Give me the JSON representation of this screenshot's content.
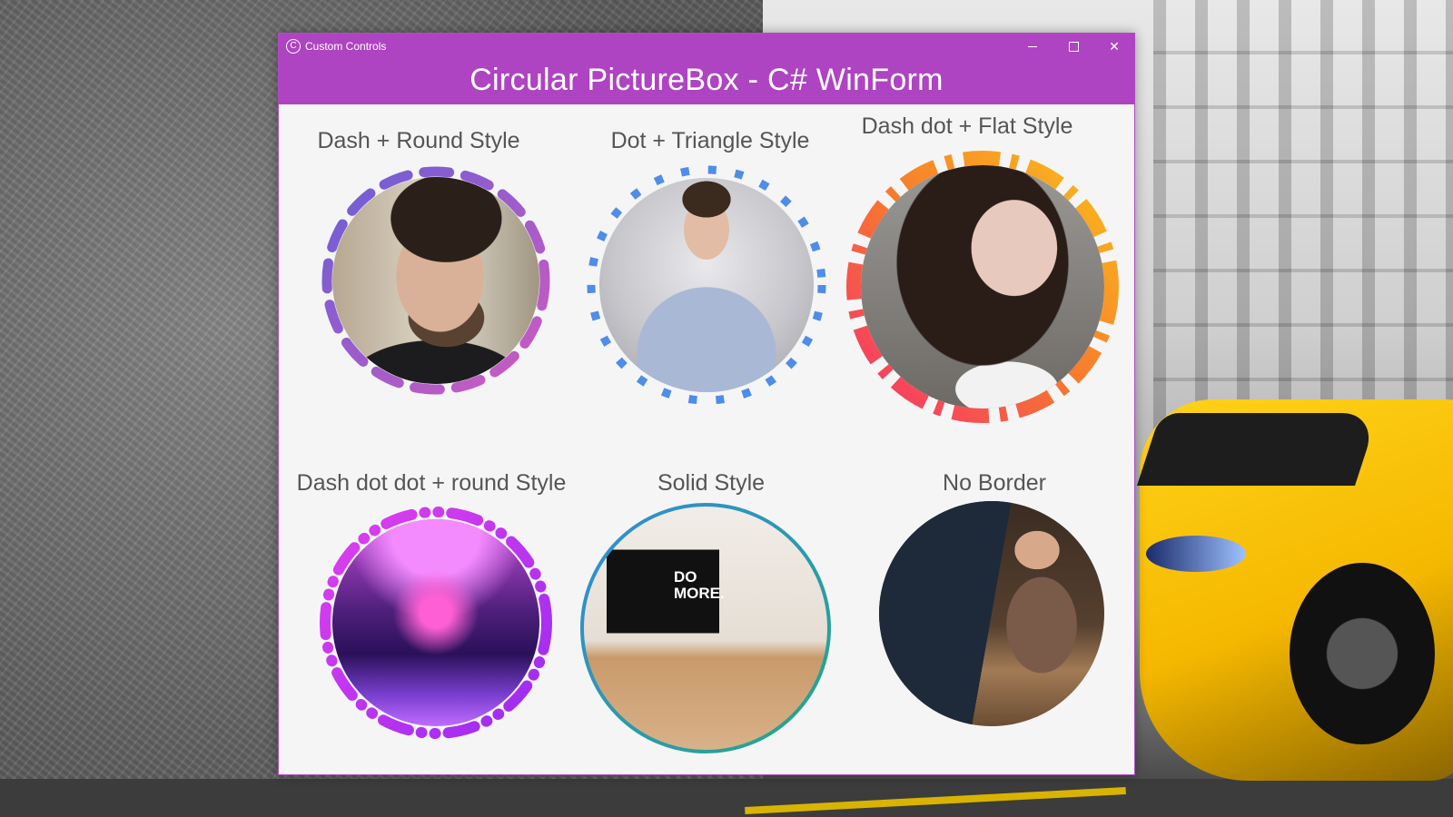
{
  "window": {
    "title": "Custom Controls",
    "header_title": "Circular PictureBox - C# WinForm",
    "accent_color": "#ae44c1",
    "controls": [
      "minimize-icon",
      "maximize-icon",
      "close-icon"
    ]
  },
  "pictures": [
    {
      "label": "Dash + Round Style",
      "border": "dash-round",
      "colors": [
        "#6a5fd6",
        "#d05ac0"
      ]
    },
    {
      "label": "Dot + Triangle Style",
      "border": "dot-triangle",
      "colors": [
        "#4f8de8",
        "#4f8de8"
      ]
    },
    {
      "label": "Dash dot + Flat Style",
      "border": "dashdot-flat",
      "colors": [
        "#f9a51c",
        "#f5306f"
      ]
    },
    {
      "label": "Dash dot dot + round Style",
      "border": "dashdotdot-round",
      "colors": [
        "#d438e8",
        "#9a2bf0"
      ]
    },
    {
      "label": "Solid Style",
      "border": "solid",
      "colors": [
        "#2f8dd6",
        "#26a689"
      ]
    },
    {
      "label": "No Border",
      "border": "none",
      "colors": []
    }
  ],
  "photo_art": {
    "desk_text": "DO MORE."
  }
}
